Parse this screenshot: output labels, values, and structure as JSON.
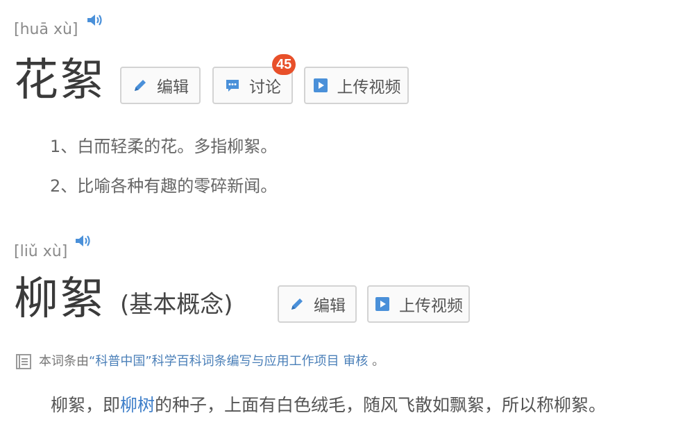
{
  "entry1": {
    "pinyin": "[huā xù]",
    "term": "花絮",
    "buttons": {
      "edit": "编辑",
      "discuss": "讨论",
      "discuss_count": "45",
      "upload": "上传视频"
    },
    "definitions": [
      "1、白而轻柔的花。多指柳絮。",
      "2、比喻各种有趣的零碎新闻。"
    ]
  },
  "entry2": {
    "pinyin": "[liǔ xù]",
    "term": "柳絮",
    "concept": "(基本概念)",
    "buttons": {
      "edit": "编辑",
      "upload": "上传视频"
    },
    "review_note": {
      "prefix": "本词条由",
      "link": "“科普中国”科学百科词条编写与应用工作项目",
      "suffix": "审核",
      "end": "。"
    },
    "summary": {
      "before": "柳絮，即",
      "link": "柳树",
      "after": "的种子，上面有白色绒毛，随风飞散如飘絮，所以称柳絮。"
    }
  },
  "colors": {
    "accent_blue": "#3d7ec9",
    "icon_blue": "#4a90d9",
    "badge_red": "#e8502a"
  }
}
